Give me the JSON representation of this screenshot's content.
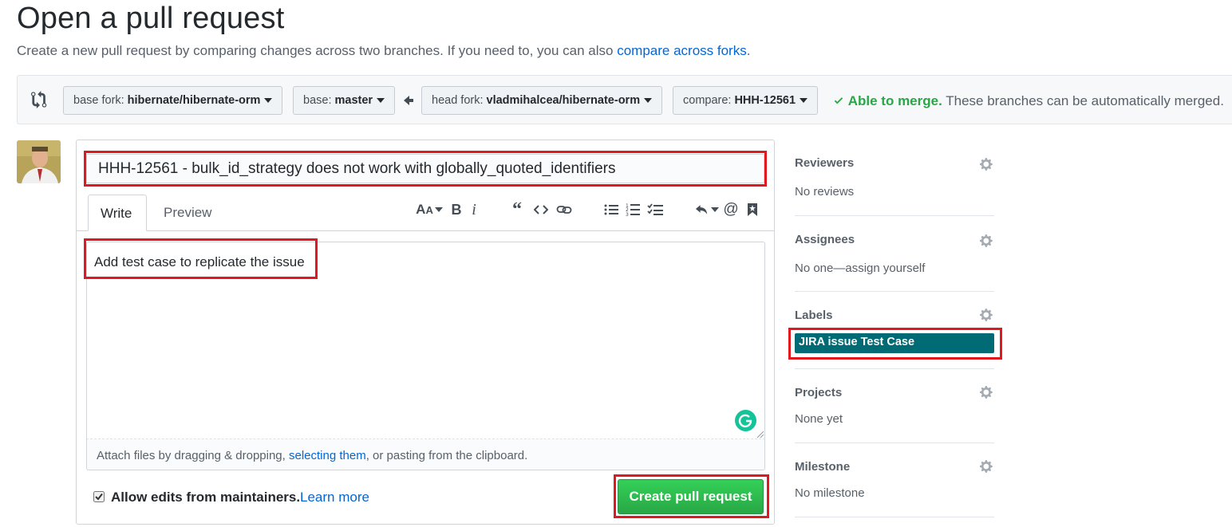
{
  "header": {
    "title": "Open a pull request",
    "subtitle": "Create a new pull request by comparing changes across two branches. If you need to, you can also ",
    "subtitle_link": "compare across forks",
    "subtitle_end": "."
  },
  "range": {
    "base_fork_label": "base fork:",
    "base_fork_value": "hibernate/hibernate-orm",
    "base_label": "base:",
    "base_value": "master",
    "head_fork_label": "head fork:",
    "head_fork_value": "vladmihalcea/hibernate-orm",
    "compare_label": "compare:",
    "compare_value": "HHH-12561",
    "merge_ok": "Able to merge.",
    "merge_text": " These branches can be automatically merged."
  },
  "composer": {
    "title_value": "HHH-12561 - bulk_id_strategy does not work with globally_quoted_identifiers",
    "tab_write": "Write",
    "tab_preview": "Preview",
    "body_value": "Add test case to replicate the issue",
    "attach_prefix": "Attach files by dragging & dropping, ",
    "attach_link": "selecting them",
    "attach_suffix": ", or pasting from the clipboard.",
    "allow_edits_label": "Allow edits from maintainers.",
    "allow_edits_checked": true,
    "learn_more": "Learn more",
    "submit_label": "Create pull request"
  },
  "toolbar": {
    "icons": [
      "text-size-icon",
      "bold-icon",
      "italic-icon",
      "quote-icon",
      "code-icon",
      "link-icon",
      "unordered-list-icon",
      "ordered-list-icon",
      "task-list-icon",
      "reply-icon",
      "mention-icon",
      "bookmark-icon"
    ]
  },
  "sidebar": {
    "reviewers": {
      "heading": "Reviewers",
      "value": "No reviews"
    },
    "assignees": {
      "heading": "Assignees",
      "value": "No one—assign yourself"
    },
    "labels": {
      "heading": "Labels",
      "chip": "JIRA issue Test Case",
      "chip_color": "#006b75"
    },
    "projects": {
      "heading": "Projects",
      "value": "None yet"
    },
    "milestone": {
      "heading": "Milestone",
      "value": "No milestone"
    }
  },
  "colors": {
    "accent_link": "#0366d6",
    "success": "#28a745",
    "highlight_box": "#e0191e"
  }
}
